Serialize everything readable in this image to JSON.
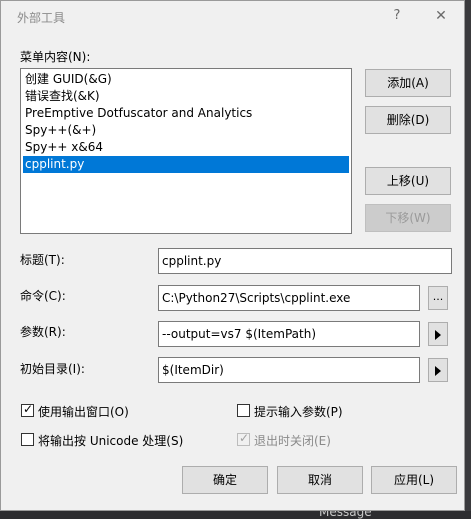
{
  "window": {
    "title": "外部工具",
    "help_glyph": "?",
    "close_glyph": "✕"
  },
  "menu_contents": {
    "label": "菜单内容(N):",
    "items": [
      "创建 GUID(&G)",
      "错误查找(&K)",
      "PreEmptive Dotfuscator and Analytics",
      "Spy++(&+)",
      "Spy++ x&64",
      "cpplint.py"
    ],
    "selected_index": 5
  },
  "side_buttons": {
    "add": "添加(A)",
    "delete": "删除(D)",
    "move_up": "上移(U)",
    "move_down": "下移(W)"
  },
  "fields": {
    "title_label": "标题(T):",
    "title_value": "cpplint.py",
    "command_label": "命令(C):",
    "command_value": "C:\\Python27\\Scripts\\cpplint.exe",
    "command_browse": "...",
    "args_label": "参数(R):",
    "args_value": "--output=vs7 $(ItemPath)",
    "initdir_label": "初始目录(I):",
    "initdir_value": "$(ItemDir)"
  },
  "checkboxes": {
    "use_output_window": {
      "label": "使用输出窗口(O)",
      "checked": true
    },
    "prompt_args": {
      "label": "提示输入参数(P)",
      "checked": false
    },
    "unicode_output": {
      "label": "将输出按 Unicode 处理(S)",
      "checked": false
    },
    "close_on_exit": {
      "label": "退出时关闭(E)",
      "checked": true,
      "disabled": true
    }
  },
  "bottom_buttons": {
    "ok": "确定",
    "cancel": "取消",
    "apply": "应用(L)"
  },
  "background": {
    "message_text": "Message"
  }
}
